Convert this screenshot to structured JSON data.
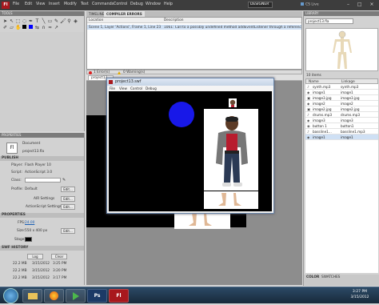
{
  "app": {
    "logo": "Fl"
  },
  "menu": [
    "File",
    "Edit",
    "View",
    "Insert",
    "Modify",
    "Text",
    "Commands",
    "Control",
    "Debug",
    "Window",
    "Help"
  ],
  "workspace": "DESIGNER",
  "cs_live": "CS Live",
  "window_controls": "– □ ×",
  "tools": {
    "title": "TOOLS"
  },
  "timeline_tab": "TIMELINE",
  "compiler_tab": "COMPILER ERRORS",
  "errors": {
    "col_location": "Location",
    "col_description": "Description",
    "row_location": "Scene 1, Layer 'Actions', Frame 1, Line 23",
    "row_description": "1061: Call to a possibly undefined method addEventListener through a reference with static ty..."
  },
  "error_counts": {
    "errors": "1 Error(s)",
    "warnings": "0 Warning(s)"
  },
  "stage_tab": "project13...",
  "swf_window": {
    "title": "project13.swf",
    "menu": [
      "File",
      "View",
      "Control",
      "Debug"
    ]
  },
  "properties": {
    "title": "PROPERTIES",
    "doc_label": "Document",
    "doc_name": "project13.fla",
    "publish_section": "PUBLISH",
    "player_label": "Player:",
    "player_value": "Flash Player 10",
    "script_label": "Script:",
    "script_value": "ActionScript 3.0",
    "class_label": "Class:",
    "profile_label": "Profile:",
    "profile_value": "Default",
    "edit_label": "Edit...",
    "air_label": "AIR Settings",
    "as_label": "ActionScript Settings",
    "properties_section": "PROPERTIES",
    "fps_label": "FPS:",
    "fps_value": "24.00",
    "size_label": "Size:",
    "size_value": "550 x 400 px",
    "stage_label": "Stage:",
    "stage_color": "#000000",
    "swf_history_section": "SWF HISTORY",
    "log_label": "Log",
    "clear_label": "Clear",
    "history": [
      {
        "size": "22.2 MB",
        "date": "3/15/2012",
        "time": "3:25 PM"
      },
      {
        "size": "22.2 MB",
        "date": "3/15/2012",
        "time": "3:20 PM"
      },
      {
        "size": "22.2 MB",
        "date": "3/15/2012",
        "time": "3:17 PM"
      }
    ]
  },
  "library": {
    "title": "LIBRARY",
    "doc": "project13.fla",
    "item_count": "10 items",
    "col_name": "Name",
    "col_linkage": "Linkage",
    "items": [
      {
        "name": "synth.mp3",
        "linkage": "synth.mp3"
      },
      {
        "name": "image1",
        "linkage": "image1"
      },
      {
        "name": "image3.jpg",
        "linkage": "image3.jpg"
      },
      {
        "name": "image2",
        "linkage": "image2"
      },
      {
        "name": "image2.jpg",
        "linkage": "image2.jpg"
      },
      {
        "name": "drums.mp3",
        "linkage": "drums.mp3"
      },
      {
        "name": "image3",
        "linkage": "image3"
      },
      {
        "name": "button 1",
        "linkage": "button1"
      },
      {
        "name": "bassline1...",
        "linkage": "bassline1.mp3"
      },
      {
        "name": "image1",
        "linkage": "image1"
      }
    ],
    "bottom_tabs": [
      "COLOR",
      "SWATCHES"
    ]
  },
  "taskbar": {
    "apps": [
      "",
      "",
      "",
      "Ps",
      "Fl"
    ],
    "time": "3:27 PM",
    "date": "3/15/2012"
  }
}
